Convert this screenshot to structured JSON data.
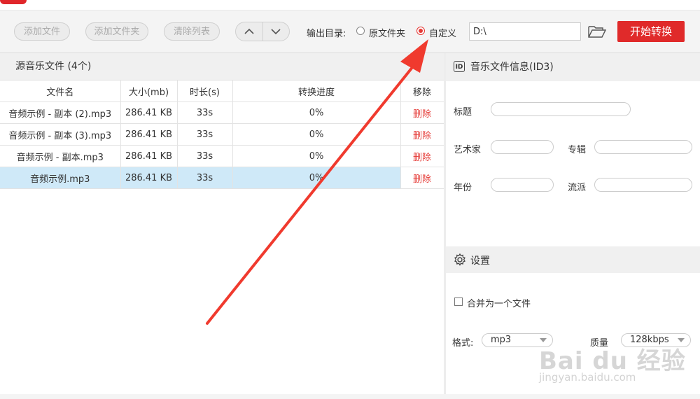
{
  "toolbar": {
    "add_file": "添加文件",
    "add_folder": "添加文件夹",
    "clear_list": "清除列表",
    "output_label": "输出目录:",
    "radio_original": "原文件夹",
    "radio_custom": "自定义",
    "output_path": "D:\\",
    "start": "开始转换",
    "icons": [
      "chevron-up-icon",
      "chevron-down-icon",
      "folder-open-icon"
    ]
  },
  "file_list": {
    "header": "源音乐文件 (4个)",
    "columns": [
      "文件名",
      "大小(mb)",
      "时长(s)",
      "转换进度",
      "移除"
    ],
    "rows": [
      {
        "name": "音频示例 - 副本 (2).mp3",
        "size": "286.41 KB",
        "duration": "33s",
        "progress": "0%",
        "remove": "删除"
      },
      {
        "name": "音频示例 - 副本 (3).mp3",
        "size": "286.41 KB",
        "duration": "33s",
        "progress": "0%",
        "remove": "删除"
      },
      {
        "name": "音频示例 - 副本.mp3",
        "size": "286.41 KB",
        "duration": "33s",
        "progress": "0%",
        "remove": "删除"
      },
      {
        "name": "音频示例.mp3",
        "size": "286.41 KB",
        "duration": "33s",
        "progress": "0%",
        "remove": "删除"
      }
    ]
  },
  "id3": {
    "badge": "ID",
    "title": "音乐文件信息(ID3)",
    "field_title": "标题",
    "field_artist": "艺术家",
    "field_album": "专辑",
    "field_year": "年份",
    "field_genre": "流派"
  },
  "settings": {
    "title": "设置",
    "merge_label": "合并为一个文件",
    "format_label": "格式:",
    "format_value": "mp3",
    "quality_label": "质量",
    "quality_value": "128kbps"
  },
  "watermark": {
    "brand": "Bai du 经验",
    "url": "jingyan.baidu.com"
  },
  "colors": {
    "accent": "#e02a2a",
    "selected_row": "#cfe9f8",
    "annotation_arrow": "#f03a2e"
  }
}
